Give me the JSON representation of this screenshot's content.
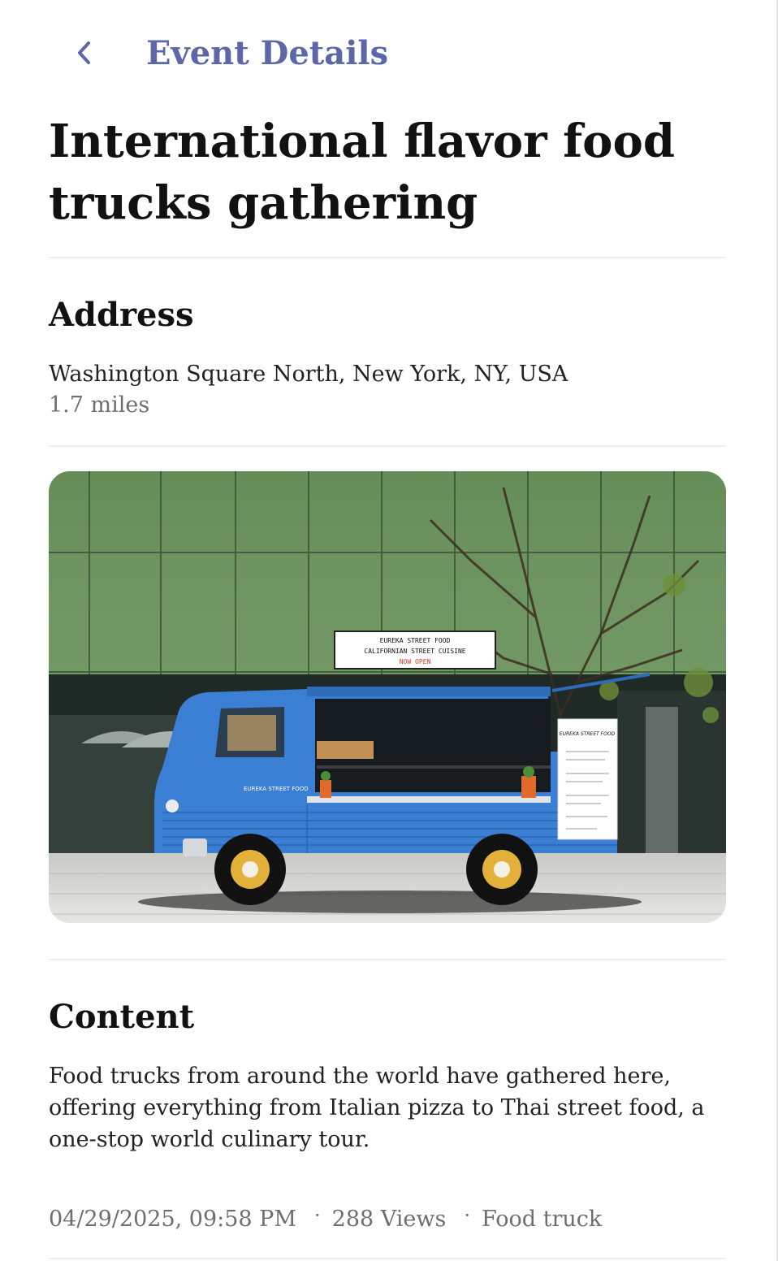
{
  "header": {
    "title": "Event Details"
  },
  "event": {
    "title": "International flavor food trucks gathering"
  },
  "address": {
    "heading": "Address",
    "text": "Washington Square North, New York, NY, USA",
    "distance": "1.7 miles"
  },
  "photo": {
    "sign_line1": "EUREKA STREET FOOD",
    "sign_line2": "CALIFORNIAN STREET CUISINE",
    "sign_line3": "NOW OPEN",
    "truck_label": "EUREKA STREET FOOD",
    "menu_board": "EUREKA STREET FOOD"
  },
  "content": {
    "heading": "Content",
    "text": "Food trucks from around the world have gathered here, offering everything from Italian pizza to Thai street food, a one-stop world culinary tour."
  },
  "meta": {
    "datetime": "04/29/2025, 09:58 PM",
    "separator": "·",
    "views": "288 Views",
    "category": "Food truck"
  },
  "colors": {
    "accent": "#5b67a8",
    "divider": "#eeeeee",
    "muted_text": "#6e6e6e",
    "truck_blue": "#3a7fd4",
    "wall_green": "#6e9561"
  },
  "icons": {
    "back": "chevron-left-icon"
  }
}
